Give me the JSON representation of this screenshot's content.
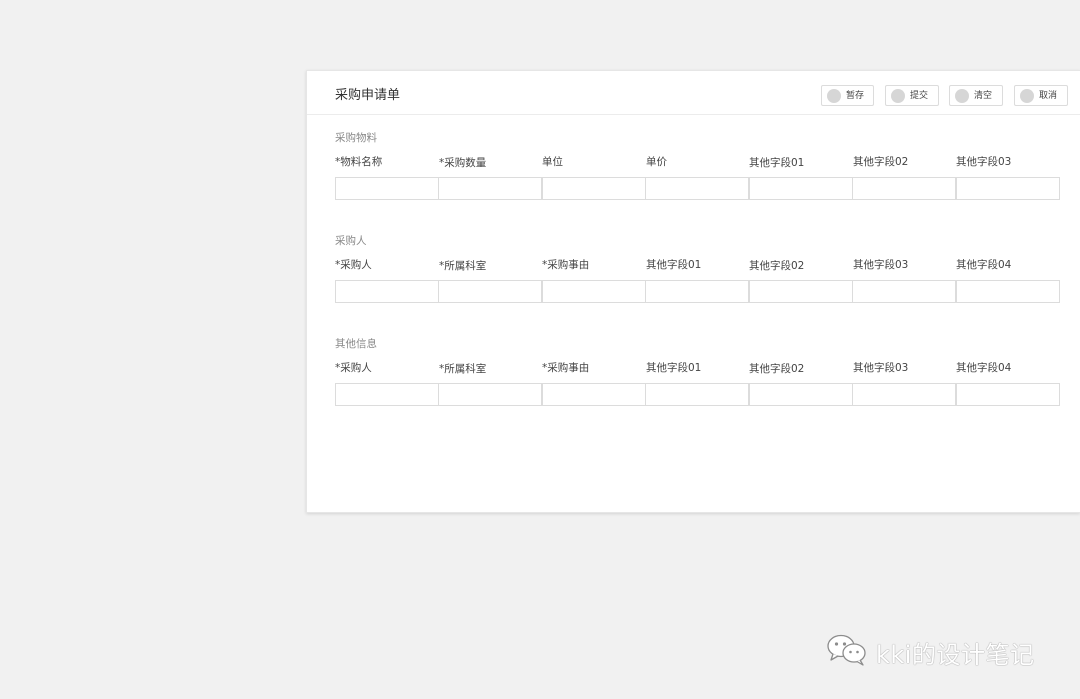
{
  "form": {
    "title": "采购申请单",
    "actions": [
      {
        "label": "暂存",
        "icon": "circle-icon"
      },
      {
        "label": "提交",
        "icon": "circle-icon"
      },
      {
        "label": "清空",
        "icon": "circle-icon"
      },
      {
        "label": "取消",
        "icon": "circle-icon"
      }
    ],
    "sections": [
      {
        "title": "采购物料",
        "columns": [
          "*物料名称",
          "*采购数量",
          "单位",
          "单价",
          "其他字段01",
          "其他字段02",
          "其他字段03"
        ]
      },
      {
        "title": "采购人",
        "columns": [
          "*采购人",
          "*所属科室",
          "*采购事由",
          "其他字段01",
          "其他字段02",
          "其他字段03",
          "其他字段04"
        ]
      },
      {
        "title": "其他信息",
        "columns": [
          "*采购人",
          "*所属科室",
          "*采购事由",
          "其他字段01",
          "其他字段02",
          "其他字段03",
          "其他字段04"
        ]
      }
    ]
  },
  "watermark": {
    "text": "kki的设计笔记",
    "icon": "wechat-icon"
  },
  "colors": {
    "background": "#f1f1f1",
    "card": "#ffffff",
    "border": "#dcdcdc",
    "icon_dot": "#d6d6d6"
  }
}
